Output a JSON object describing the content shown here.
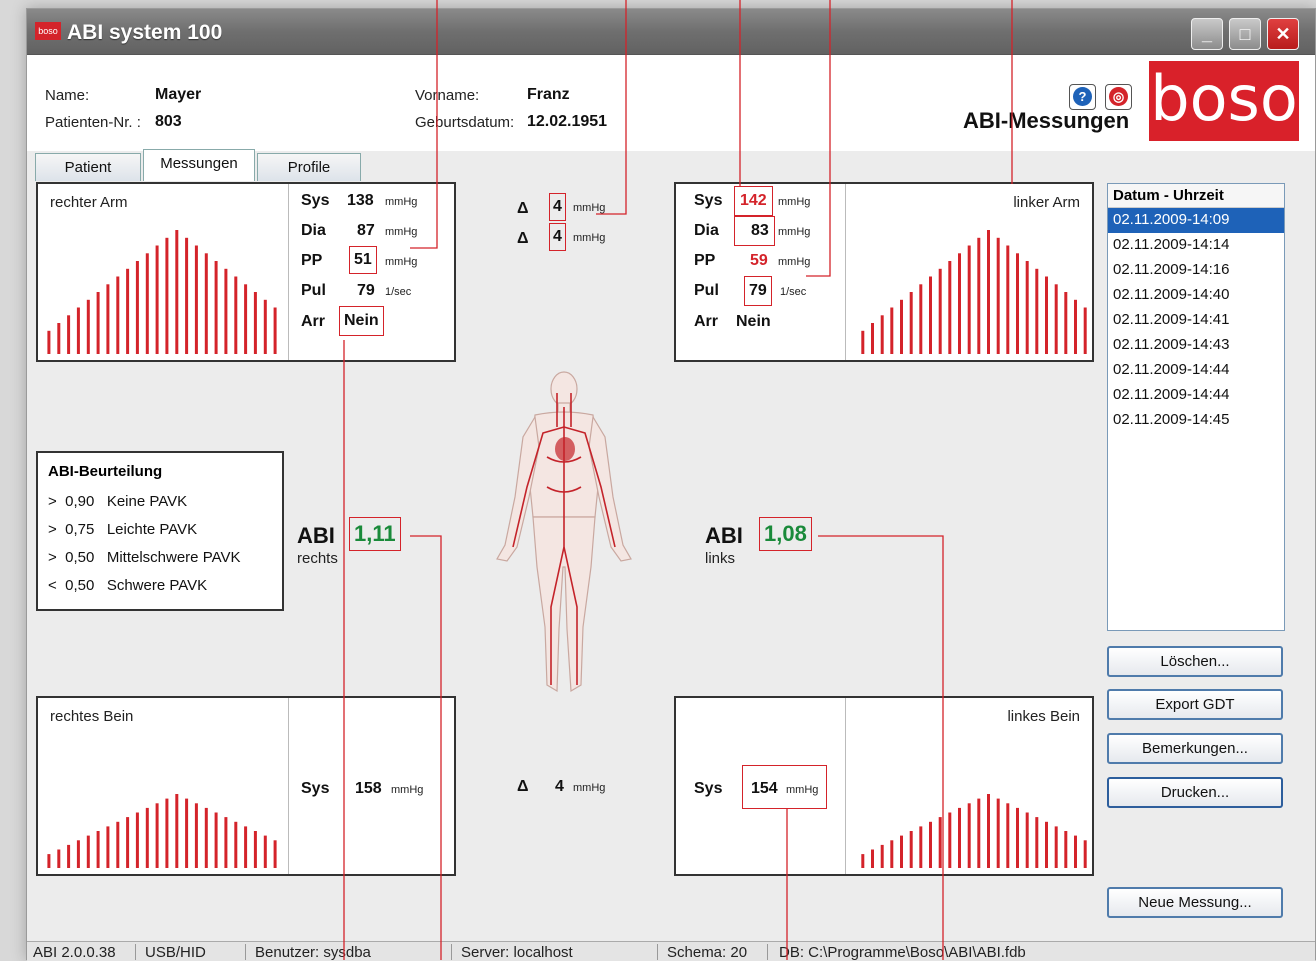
{
  "window": {
    "title": "ABI system 100",
    "logo_small": "boso",
    "controls": {
      "minimize": "_",
      "maximize": "□",
      "close": "✕"
    }
  },
  "header": {
    "name_label": "Name:",
    "name_value": "Mayer",
    "patient_nr_label": "Patienten-Nr. :",
    "patient_nr_value": "803",
    "vorname_label": "Vorname:",
    "vorname_value": "Franz",
    "geburtsdatum_label": "Geburtsdatum:",
    "geburtsdatum_value": "12.02.1951",
    "section_title": "ABI-Messungen",
    "help_icon": "?",
    "info_icon": "◎",
    "logo_text": "boso"
  },
  "tabs": [
    "Patient",
    "Messungen",
    "Profile"
  ],
  "active_tab": "Messungen",
  "right_arm": {
    "title": "rechter Arm",
    "sys_label": "Sys",
    "sys_value": "138",
    "sys_unit": "mmHg",
    "dia_label": "Dia",
    "dia_value": "87",
    "dia_unit": "mmHg",
    "pp_label": "PP",
    "pp_value": "51",
    "pp_unit": "mmHg",
    "pul_label": "Pul",
    "pul_value": "79",
    "pul_unit": "1/sec",
    "arr_label": "Arr",
    "arr_value": "Nein",
    "bars": [
      3,
      4,
      5,
      6,
      7,
      8,
      9,
      10,
      11,
      12,
      13,
      14,
      15,
      16,
      15,
      14,
      13,
      12,
      11,
      10,
      9,
      8,
      7,
      6
    ]
  },
  "left_arm": {
    "title": "linker Arm",
    "sys_label": "Sys",
    "sys_value": "142",
    "sys_unit": "mmHg",
    "dia_label": "Dia",
    "dia_value": "83",
    "dia_unit": "mmHg",
    "pp_label": "PP",
    "pp_value": "59",
    "pp_unit": "mmHg",
    "pul_label": "Pul",
    "pul_value": "79",
    "pul_unit": "1/sec",
    "arr_label": "Arr",
    "arr_value": "Nein",
    "bars": [
      3,
      4,
      5,
      6,
      7,
      8,
      9,
      10,
      11,
      12,
      13,
      14,
      15,
      16,
      15,
      14,
      13,
      12,
      11,
      10,
      9,
      8,
      7,
      6
    ]
  },
  "arm_delta": {
    "symbol": "Δ",
    "sys_value": "4",
    "sys_unit": "mmHg",
    "dia_value": "4",
    "dia_unit": "mmHg"
  },
  "evaluation": {
    "title": "ABI-Beurteilung",
    "items": [
      {
        "op": ">",
        "value": "0,90",
        "text": "Keine PAVK"
      },
      {
        "op": ">",
        "value": "0,75",
        "text": "Leichte PAVK"
      },
      {
        "op": ">",
        "value": "0,50",
        "text": "Mittelschwere PAVK"
      },
      {
        "op": "<",
        "value": "0,50",
        "text": "Schwere PAVK"
      }
    ]
  },
  "abi_right": {
    "label": "ABI",
    "sub": "rechts",
    "value": "1,11"
  },
  "abi_left": {
    "label": "ABI",
    "sub": "links",
    "value": "1,08"
  },
  "right_leg": {
    "title": "rechtes Bein",
    "sys_label": "Sys",
    "sys_value": "158",
    "sys_unit": "mmHg",
    "bars": [
      3,
      4,
      5,
      6,
      7,
      8,
      9,
      10,
      11,
      12,
      13,
      14,
      15,
      16,
      15,
      14,
      13,
      12,
      11,
      10,
      9,
      8,
      7,
      6
    ]
  },
  "left_leg": {
    "title": "linkes Bein",
    "sys_label": "Sys",
    "sys_value": "154",
    "sys_unit": "mmHg",
    "bars": [
      3,
      4,
      5,
      6,
      7,
      8,
      9,
      10,
      11,
      12,
      13,
      14,
      15,
      16,
      15,
      14,
      13,
      12,
      11,
      10,
      9,
      8,
      7,
      6
    ]
  },
  "leg_delta": {
    "symbol": "Δ",
    "value": "4",
    "unit": "mmHg"
  },
  "measurements": {
    "header": "Datum - Uhrzeit",
    "items": [
      "02.11.2009-14:09",
      "02.11.2009-14:14",
      "02.11.2009-14:16",
      "02.11.2009-14:40",
      "02.11.2009-14:41",
      "02.11.2009-14:43",
      "02.11.2009-14:44",
      "02.11.2009-14:44",
      "02.11.2009-14:45"
    ],
    "selected_index": 0
  },
  "buttons": {
    "loeschen": "Löschen...",
    "export": "Export GDT",
    "bemerkungen": "Bemerkungen...",
    "drucken": "Drucken...",
    "neue_messung": "Neue Messung..."
  },
  "status": {
    "version": "ABI 2.0.0.38",
    "interface": "USB/HID",
    "user": "Benutzer: sysdba",
    "server": "Server: localhost",
    "schema": "Schema: 20",
    "db": "DB: C:\\Programme\\Boso\\ABI\\ABI.fdb"
  },
  "colors": {
    "accent_red": "#d4232a",
    "abi_green": "#1a8a3a",
    "selection_blue": "#1e62b8"
  }
}
